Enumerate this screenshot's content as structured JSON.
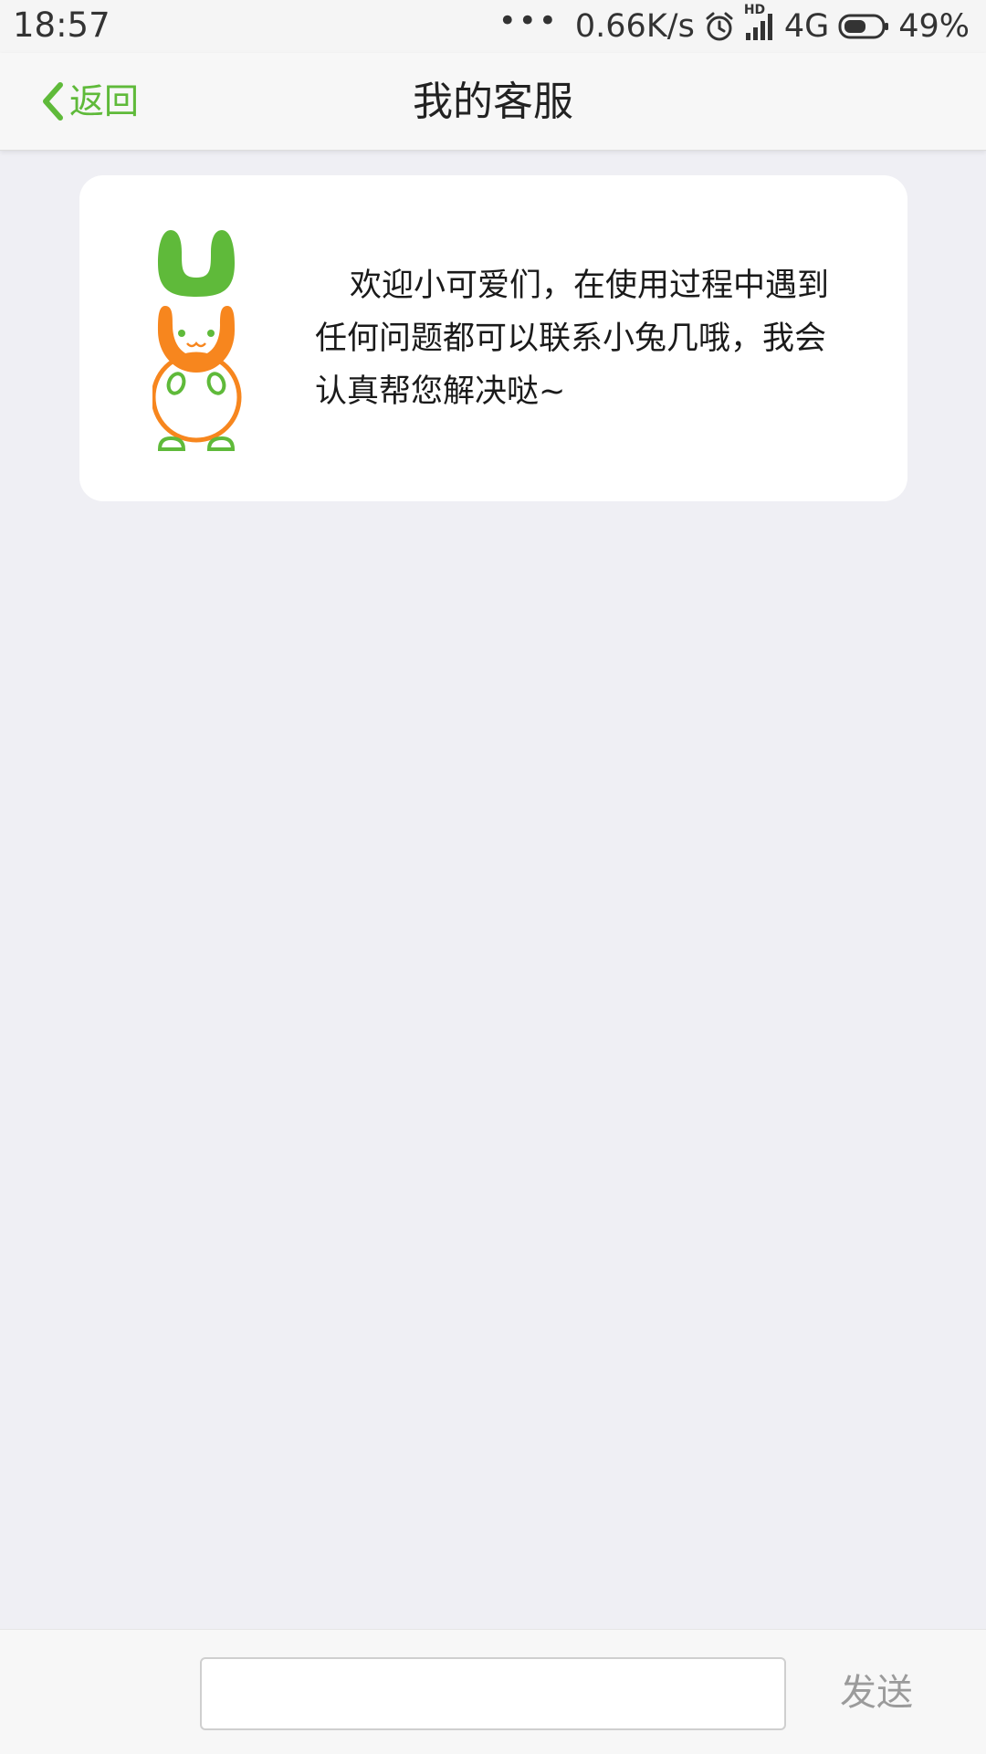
{
  "status_bar": {
    "time": "18:57",
    "dots": "•••",
    "network_speed": "0.66K/s",
    "hd_label": "HD",
    "network_type": "4G",
    "battery_percent": "49%",
    "icons": [
      "alarm-icon",
      "signal-icon",
      "battery-icon"
    ]
  },
  "nav": {
    "back_label": "返回",
    "title": "我的客服"
  },
  "welcome": {
    "message": "欢迎小可爱们，在使用过程中遇到任何问题都可以联系小兔几哦，我会认真帮您解决哒~",
    "mascot": "rabbit-mascot"
  },
  "composer": {
    "input_value": "",
    "input_placeholder": "",
    "send_label": "发送"
  },
  "colors": {
    "accent_green": "#5fba3a",
    "mascot_orange": "#f7861e",
    "background": "#efeff4",
    "send_gray": "#9b9b9b"
  }
}
